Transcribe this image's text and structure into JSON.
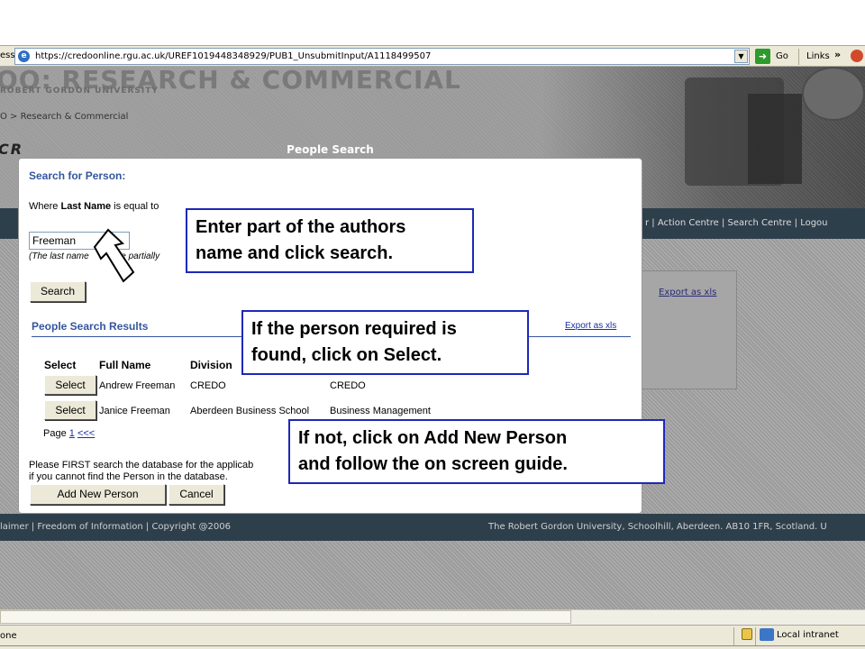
{
  "browser": {
    "address_label": "ess",
    "url": "https://credoonline.rgu.ac.uk/UREF1019448348929/PUB1_UnsubmitInput/A1118499507",
    "go_label": "Go",
    "links_label": "Links",
    "links_more": "»"
  },
  "background": {
    "logo": "OO: RESEARCH & COMMERCIAL",
    "university": "ROBERT GORDON UNIVERSITY",
    "breadcrumb": "O > Research & Commercial",
    "heading": "CR",
    "nav_links": "r | Action Centre | Search Centre | Logou",
    "export_link": "Export as xls",
    "footer_left": "laimer | Freedom of Information | Copyright @2006",
    "footer_right": "The Robert Gordon University, Schoolhill, Aberdeen. AB10 1FR, Scotland. U"
  },
  "dialog": {
    "title": "People Search",
    "search_section_title": "Search for Person:",
    "where_prefix": "Where ",
    "where_field": "Last Name",
    "where_suffix": " is equal to",
    "search_value": "Freeman",
    "hint_left": "(The last name",
    "hint_right": "be partially",
    "search_button": "Search",
    "results_title": "People Search Results",
    "export_link": "Export as xls",
    "columns": [
      "Select",
      "Full Name",
      "Division"
    ],
    "rows": [
      {
        "select_label": "Select",
        "full_name": "Andrew Freeman",
        "division": "CREDO",
        "department": "CREDO"
      },
      {
        "select_label": "Select",
        "full_name": "Janice Freeman",
        "division": "Aberdeen Business School",
        "department": "Business Management"
      }
    ],
    "pager_prefix": "Page ",
    "pager_page": "1",
    "pager_prev": "<<<",
    "note_line1": "Please FIRST search the database for the applicab",
    "note_line2": "if you cannot find the Person in the database.",
    "add_button": "Add New Person",
    "cancel_button": "Cancel"
  },
  "callouts": {
    "c1_line1": "Enter part of the authors",
    "c1_line2": "name and click search.",
    "c2_line1": "If the person required is",
    "c2_line2": "found, click on Select.",
    "c3_line1": "If not, click on Add New Person",
    "c3_line2": "and follow the on screen guide."
  },
  "statusbar": {
    "left_text": "one",
    "zone": "Local intranet"
  }
}
